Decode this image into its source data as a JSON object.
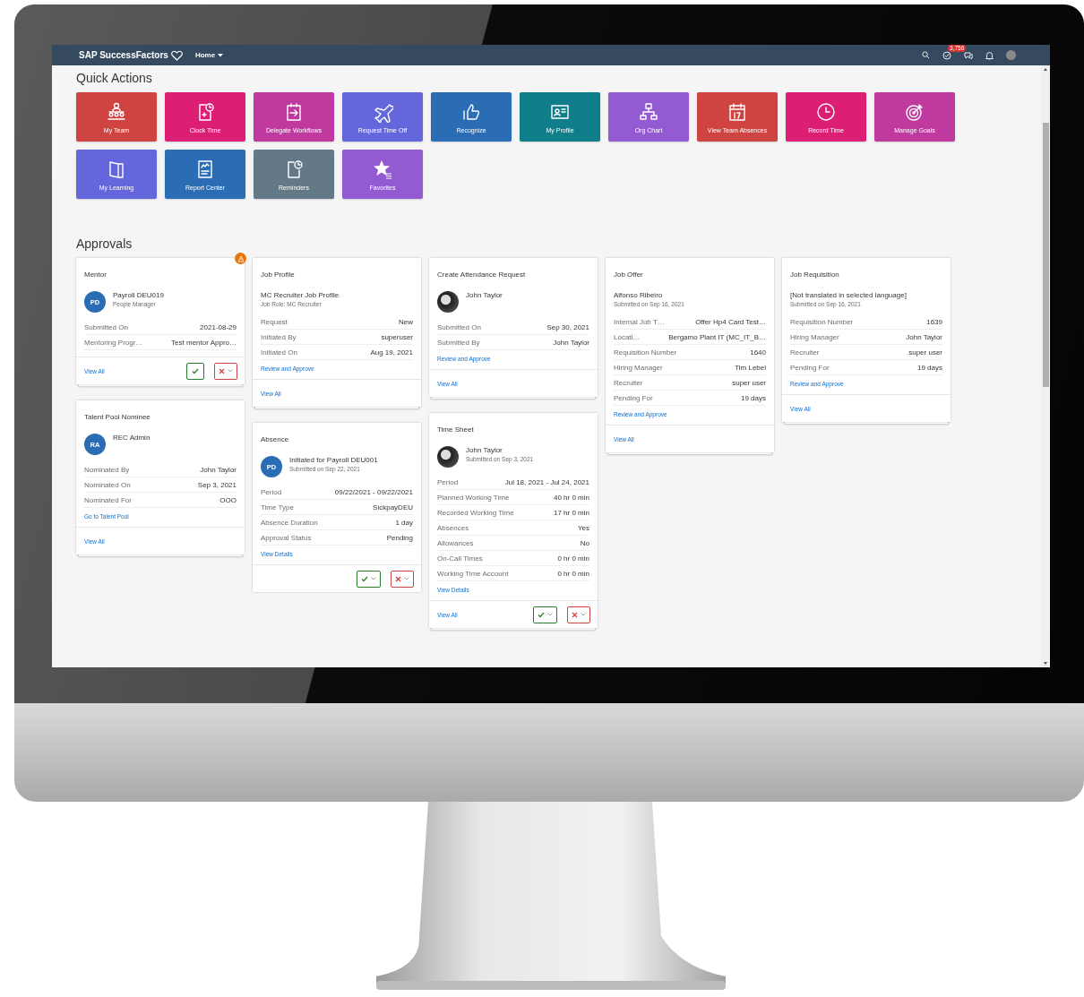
{
  "header": {
    "brand": "SAP SuccessFactors",
    "menu": "Home",
    "badge": "3,756"
  },
  "quick_actions": {
    "title": "Quick Actions",
    "tiles": [
      {
        "label": "My Team",
        "kind": "team",
        "color": "#cf4441"
      },
      {
        "label": "Clock Time",
        "kind": "clock",
        "color": "#dc1f74"
      },
      {
        "label": "Delegate Workflows",
        "kind": "delegate",
        "color": "#bf399e"
      },
      {
        "label": "Request Time Off",
        "kind": "plane",
        "color": "#6467db"
      },
      {
        "label": "Recognize",
        "kind": "thumb",
        "color": "#2a6db4"
      },
      {
        "label": "My Profile",
        "kind": "profile",
        "color": "#107e8a"
      },
      {
        "label": "Org Chart",
        "kind": "org",
        "color": "#945ad1"
      },
      {
        "label": "View Team Absences",
        "kind": "calendar",
        "color": "#cf4441"
      },
      {
        "label": "Record Time",
        "kind": "time",
        "color": "#dc1f74"
      },
      {
        "label": "Manage Goals",
        "kind": "target",
        "color": "#bf399e"
      },
      {
        "label": "My Learning",
        "kind": "book",
        "color": "#6467db"
      },
      {
        "label": "Report Center",
        "kind": "report",
        "color": "#2a6db4"
      },
      {
        "label": "Reminders",
        "kind": "reminder",
        "color": "#647987"
      },
      {
        "label": "Favorites",
        "kind": "star",
        "color": "#945ad1"
      }
    ]
  },
  "approvals": {
    "title": "Approvals",
    "columns": [
      [
        {
          "title": "Mentor",
          "warning": true,
          "stacked": true,
          "avatar": {
            "kind": "initials",
            "text": "PD"
          },
          "name": "Payroll DEU019",
          "subtitle": "People Manager",
          "rows": [
            {
              "label": "Submitted On",
              "value": "2021-08-29"
            },
            {
              "label": "Mentoring Progr…",
              "value": "Test mentor Appro…"
            }
          ],
          "view_all": "View All",
          "approve": {
            "has_menu": false
          },
          "reject": {
            "has_menu": true
          }
        },
        {
          "title": "Talent Pool Nominee",
          "warning": false,
          "stacked": true,
          "avatar": {
            "kind": "initials",
            "text": "RA"
          },
          "name": "REC Admin",
          "rows": [
            {
              "label": "Nominated By",
              "value": "John Taylor"
            },
            {
              "label": "Nominated On",
              "value": "Sep 3, 2021"
            },
            {
              "label": "Nominated For",
              "value": "OOO"
            }
          ],
          "link": "Go to Talent Pool",
          "view_all": "View All"
        }
      ],
      [
        {
          "title": "Job Profile",
          "warning": false,
          "stacked": true,
          "avatar": {
            "kind": "none"
          },
          "name": "MC Recruiter Job Profile",
          "subtitle": "Job Role: MC Recruiter",
          "rows": [
            {
              "label": "Request",
              "value": "New"
            },
            {
              "label": "Initiated By",
              "value": "superuser"
            },
            {
              "label": "Initiated On",
              "value": "Aug 19, 2021"
            }
          ],
          "link": "Review and Approve",
          "view_all": "View All"
        },
        {
          "title": "Absence",
          "warning": false,
          "stacked": false,
          "avatar": {
            "kind": "initials",
            "text": "PD"
          },
          "name": "Initiated for Payroll DEU001",
          "subtitle": "Submitted on Sep 22, 2021",
          "rows": [
            {
              "label": "Period",
              "value": "09/22/2021 - 09/22/2021"
            },
            {
              "label": "Time Type",
              "value": "SickpayDEU"
            },
            {
              "label": "Absence Duration",
              "value": "1 day"
            },
            {
              "label": "Approval Status",
              "value": "Pending"
            }
          ],
          "link": "View Details",
          "approve": {
            "has_menu": true
          },
          "reject": {
            "has_menu": true
          }
        }
      ],
      [
        {
          "title": "Create Attendance Request",
          "warning": false,
          "stacked": true,
          "avatar": {
            "kind": "photo"
          },
          "name": "John Taylor",
          "rows": [
            {
              "label": "Submitted On",
              "value": "Sep 30, 2021"
            },
            {
              "label": "Submitted By",
              "value": "John Taylor"
            }
          ],
          "link": "Review and Approve",
          "view_all": "View All"
        },
        {
          "title": "Time Sheet",
          "warning": false,
          "stacked": true,
          "avatar": {
            "kind": "photo"
          },
          "name": "John Taylor",
          "subtitle": "Submitted on Sep 3, 2021",
          "rows": [
            {
              "label": "Period",
              "value": "Jul 18, 2021 - Jul 24, 2021"
            },
            {
              "label": "Planned Working Time",
              "value": "40 hr 0 min"
            },
            {
              "label": "Recorded Working Time",
              "value": "17 hr 0 min"
            },
            {
              "label": "Absences",
              "value": "Yes"
            },
            {
              "label": "Allowances",
              "value": "No"
            },
            {
              "label": "On-Call Times",
              "value": "0 hr 0 min"
            },
            {
              "label": "Working Time Account",
              "value": "0 hr 0 min"
            }
          ],
          "link": "View Details",
          "view_all": "View All",
          "approve": {
            "has_menu": true
          },
          "reject": {
            "has_menu": true
          }
        }
      ],
      [
        {
          "title": "Job Offer",
          "warning": false,
          "stacked": true,
          "avatar": {
            "kind": "none"
          },
          "name": "Alfonso Ribeiro",
          "subtitle": "Submitted on Sep 16, 2021",
          "rows": [
            {
              "label": "Internal Job T…",
              "value": "Offer Hp4 Card Test…"
            },
            {
              "label": "Locati…",
              "value": "Bergamo Plant IT (MC_IT_B…"
            },
            {
              "label": "Requisition Number",
              "value": "1640"
            },
            {
              "label": "Hiring Manager",
              "value": "Tim Lebel"
            },
            {
              "label": "Recruiter",
              "value": "super user"
            },
            {
              "label": "Pending For",
              "value": "19 days"
            }
          ],
          "link": "Review and Approve",
          "view_all": "View All"
        }
      ],
      [
        {
          "title": "Job Requisition",
          "warning": false,
          "stacked": true,
          "avatar": {
            "kind": "none"
          },
          "name": "[Not translated in selected language]",
          "subtitle": "Submitted on Sep 16, 2021",
          "rows": [
            {
              "label": "Requisition Number",
              "value": "1639"
            },
            {
              "label": "Hiring Manager",
              "value": "John Taylor"
            },
            {
              "label": "Recruiter",
              "value": "super user"
            },
            {
              "label": "Pending For",
              "value": "19 days"
            }
          ],
          "link": "Review and Approve",
          "view_all": "View All"
        }
      ]
    ]
  }
}
